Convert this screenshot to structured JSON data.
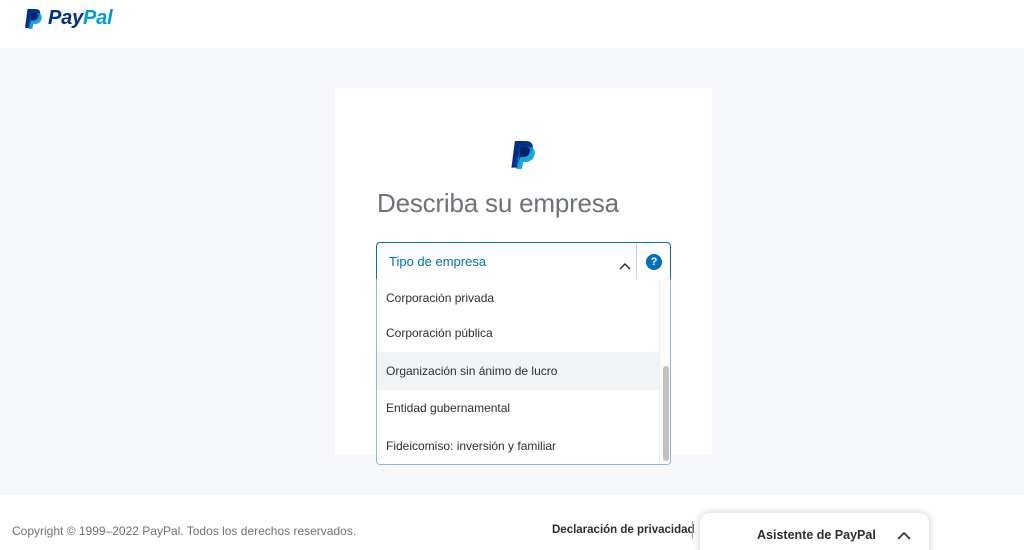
{
  "brand": {
    "name_part1": "Pay",
    "name_part2": "Pal",
    "colors": {
      "navy": "#003087",
      "light_blue": "#009cde",
      "accent": "#0070ba"
    }
  },
  "form": {
    "title": "Describa su empresa",
    "select": {
      "selected_value": "Tipo de empresa",
      "help_icon": "?",
      "expanded": true,
      "options": [
        {
          "label": "Corporación privada"
        },
        {
          "label": "Corporación pública"
        },
        {
          "label": "Organización sin ánimo de lucro",
          "highlighted": true
        },
        {
          "label": "Entidad gubernamental"
        },
        {
          "label": "Fideicomiso: inversión y familiar"
        }
      ]
    }
  },
  "footer": {
    "copyright": "Copyright © 1999–2022 PayPal. Todos los derechos reservados.",
    "privacy_link": "Declaración de privacidad"
  },
  "assistant": {
    "label": "Asistente de PayPal"
  },
  "icons": {
    "logo": "paypal-logo-icon",
    "chevron": "chevron-up-icon",
    "help": "help-icon"
  }
}
